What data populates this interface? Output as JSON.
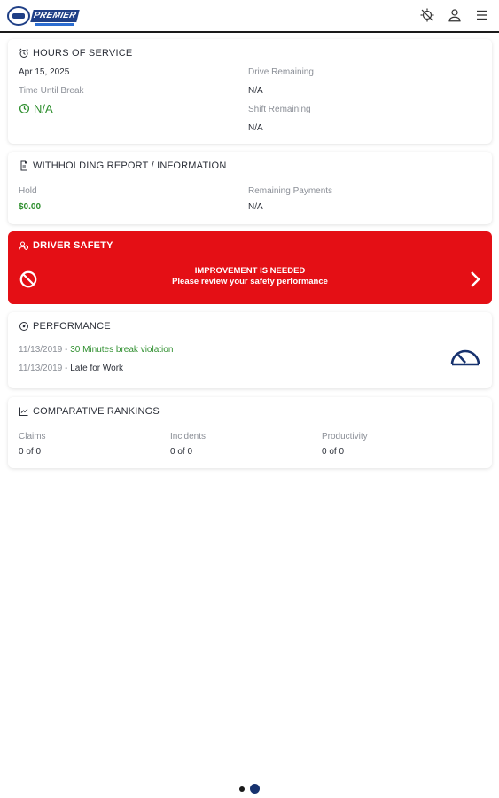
{
  "header": {
    "logo_text": "PREMIER",
    "icons": [
      "no-location-icon",
      "user-icon",
      "menu-icon"
    ]
  },
  "hours_of_service": {
    "title": "HOURS OF SERVICE",
    "date": "Apr 15, 2025",
    "time_until_break_label": "Time Until Break",
    "time_until_break_value": "N/A",
    "drive_remaining_label": "Drive Remaining",
    "drive_remaining_value": "N/A",
    "shift_remaining_label": "Shift Remaining",
    "shift_remaining_value": "N/A"
  },
  "withholding": {
    "title": "WITHHOLDING REPORT / INFORMATION",
    "hold_label": "Hold",
    "hold_value": "$0.00",
    "remaining_payments_label": "Remaining Payments",
    "remaining_payments_value": "N/A"
  },
  "driver_safety": {
    "title": "DRIVER SAFETY",
    "headline": "IMPROVEMENT IS NEEDED",
    "subline": "Please review your safety performance"
  },
  "performance": {
    "title": "PERFORMANCE",
    "items": [
      {
        "date": "11/13/2019",
        "separator": " - ",
        "text": "30 Minutes break violation"
      },
      {
        "date": "11/13/2019",
        "separator": " - ",
        "text": "Late for Work"
      }
    ]
  },
  "rankings": {
    "title": "COMPARATIVE RANKINGS",
    "columns": [
      {
        "label": "Claims",
        "value": "0 of 0"
      },
      {
        "label": "Incidents",
        "value": "0 of 0"
      },
      {
        "label": "Productivity",
        "value": "0 of 0"
      }
    ]
  },
  "pager": {
    "count": 2,
    "active_index": 1
  },
  "colors": {
    "brand": "#1f3f86",
    "alert": "#e40f15",
    "positive": "#2f8f2f"
  }
}
